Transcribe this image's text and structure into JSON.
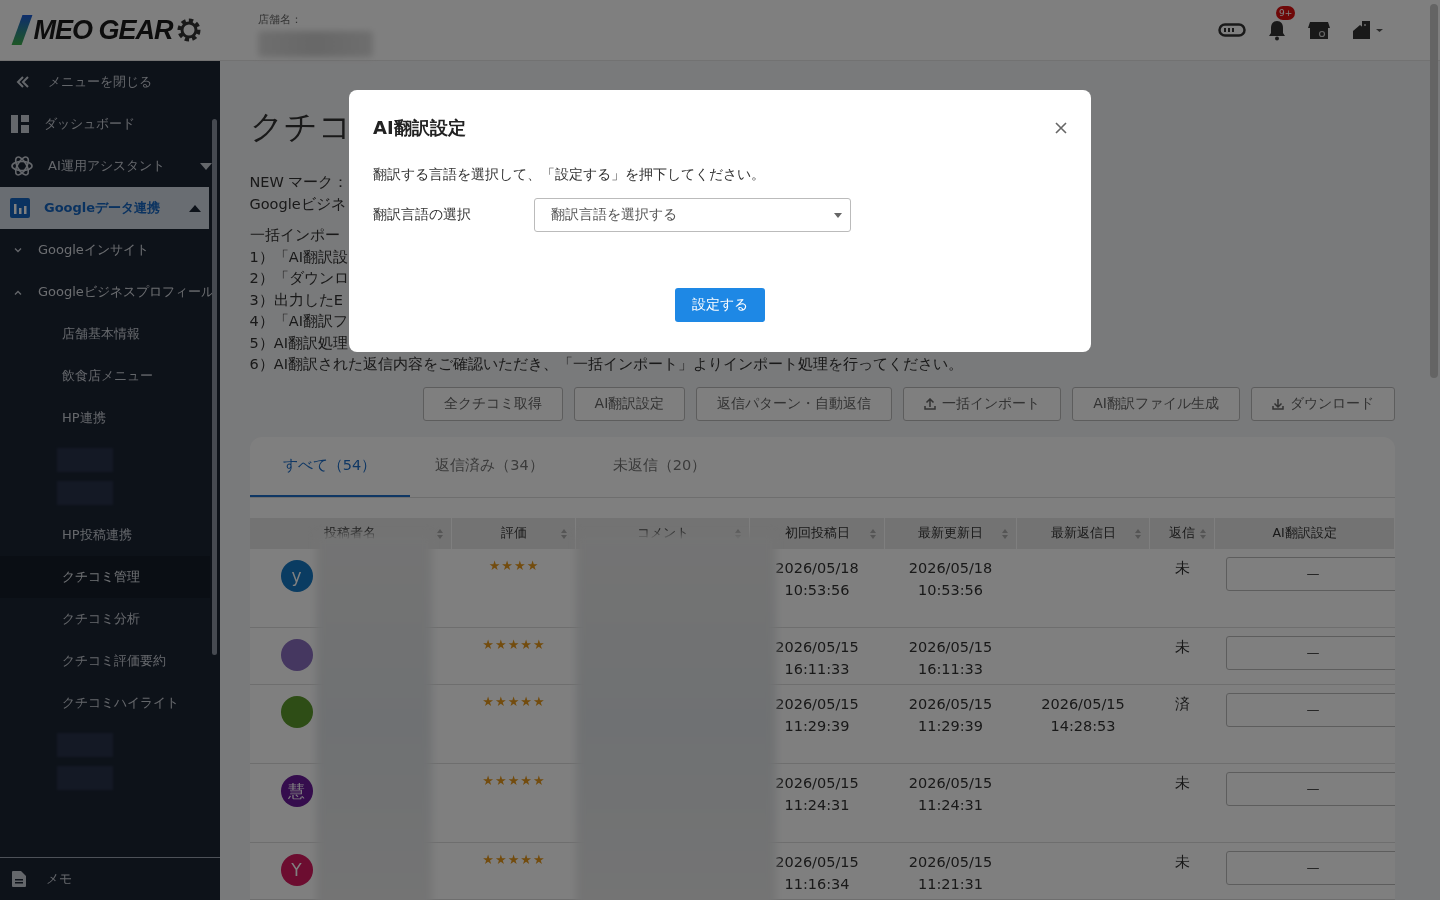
{
  "header": {
    "logo": "MEO GEAR",
    "store_label": "店舗名：",
    "notification_badge": "9+"
  },
  "sidebar": {
    "close_label": "メニューを閉じる",
    "footer": "メモ",
    "items": [
      {
        "kind": "nav",
        "label": "ダッシュボード",
        "selected": false
      },
      {
        "kind": "nav",
        "label": "AI運用アシスタント",
        "selected": false,
        "expanded": false
      },
      {
        "kind": "nav",
        "label": "Googleデータ連携",
        "selected": true,
        "expanded": true,
        "children": [
          {
            "kind": "group",
            "label": "Googleインサイト",
            "expanded": false
          },
          {
            "kind": "group",
            "label": "Googleビジネスプロフィール",
            "expanded": true,
            "children": [
              {
                "kind": "link",
                "label": "店舗基本情報",
                "selected": false
              },
              {
                "kind": "link",
                "label": "飲食店メニュー",
                "selected": false
              },
              {
                "kind": "link",
                "label": "HP連携",
                "selected": false
              },
              {
                "kind": "redacted"
              },
              {
                "kind": "redacted"
              },
              {
                "kind": "link",
                "label": "HP投稿連携",
                "selected": false
              },
              {
                "kind": "link",
                "label": "クチコミ管理",
                "selected": true
              },
              {
                "kind": "link",
                "label": "クチコミ分析",
                "selected": false
              },
              {
                "kind": "link",
                "label": "クチコミ評価要約",
                "selected": false
              },
              {
                "kind": "link",
                "label": "クチコミハイライト",
                "selected": false
              },
              {
                "kind": "redacted"
              },
              {
                "kind": "redacted"
              }
            ]
          }
        ]
      }
    ]
  },
  "page": {
    "title": "クチコ",
    "notes": [
      "NEW マーク：",
      "Googleビジネ"
    ],
    "steps_title": "一括インポー",
    "steps": [
      "1）「AI翻訳設",
      "2）「ダウンロ",
      "3）出力したE",
      "4）「AI翻訳フ",
      "5）AI翻訳処理",
      "6）AI翻訳された返信内容をご確認いただき、「一括インポート」よりインポート処理を行ってください。"
    ]
  },
  "toolbar": [
    "全クチコミ取得",
    "AI翻訳設定",
    "返信パターン・自動返信",
    "一括インポート",
    "AI翻訳ファイル生成",
    "ダウンロード"
  ],
  "tabs": [
    {
      "label": "すべて（54）",
      "selected": true
    },
    {
      "label": "返信済み（34）",
      "selected": false
    },
    {
      "label": "未返信（20）",
      "selected": false
    }
  ],
  "table": {
    "columns": [
      {
        "label": "投稿者名",
        "sortable": true
      },
      {
        "label": "評価",
        "sortable": true
      },
      {
        "label": "コメント",
        "sortable": true
      },
      {
        "label": "初回投稿日",
        "sortable": true
      },
      {
        "label": "最新更新日",
        "sortable": true
      },
      {
        "label": "最新返信日",
        "sortable": true
      },
      {
        "label": "返信",
        "sortable": true
      },
      {
        "label": "AI翻訳設定",
        "sortable": false
      }
    ],
    "rows": [
      {
        "avatar": {
          "kind": "letter",
          "text": "y",
          "color": "#0a3c62"
        },
        "stars": 4,
        "first_date": "2026/05/18",
        "first_time": "10:53:56",
        "updated_date": "2026/05/18",
        "updated_time": "10:53:56",
        "reply_status": "未",
        "ai_setting": "—"
      },
      {
        "avatar": {
          "kind": "photo",
          "color": "#453760"
        },
        "stars": 5,
        "first_date": "2026/05/15",
        "first_time": "16:11:33",
        "updated_date": "2026/05/15",
        "updated_time": "16:11:33",
        "reply_status": "未",
        "ai_setting": "—"
      },
      {
        "avatar": {
          "kind": "plain",
          "color": "#2e4d16"
        },
        "stars": 5,
        "first_date": "2026/05/15",
        "first_time": "11:29:39",
        "updated_date": "2026/05/15",
        "updated_time": "11:29:39",
        "replied_date": "2026/05/15",
        "replied_time": "14:28:53",
        "reply_status": "済",
        "ai_setting": "—"
      },
      {
        "avatar": {
          "kind": "letter",
          "text": "慧",
          "color": "#350d4d"
        },
        "stars": 5,
        "first_date": "2026/05/15",
        "first_time": "11:24:31",
        "updated_date": "2026/05/15",
        "updated_time": "11:24:31",
        "reply_status": "未",
        "ai_setting": "—"
      },
      {
        "avatar": {
          "kind": "letter",
          "text": "Y",
          "color": "#6c0d30"
        },
        "stars": 5,
        "first_date": "2026/05/15",
        "first_time": "11:16:34",
        "updated_date": "2026/05/15",
        "updated_time": "11:21:31",
        "reply_status": "未",
        "ai_setting": "—"
      }
    ]
  },
  "dialog": {
    "title": "AI翻訳設定",
    "description": "翻訳する言語を選択して、「設定する」を押下してください。",
    "field_label": "翻訳言語の選択",
    "select_placeholder": "翻訳言語を選択する",
    "submit": "設定する"
  }
}
